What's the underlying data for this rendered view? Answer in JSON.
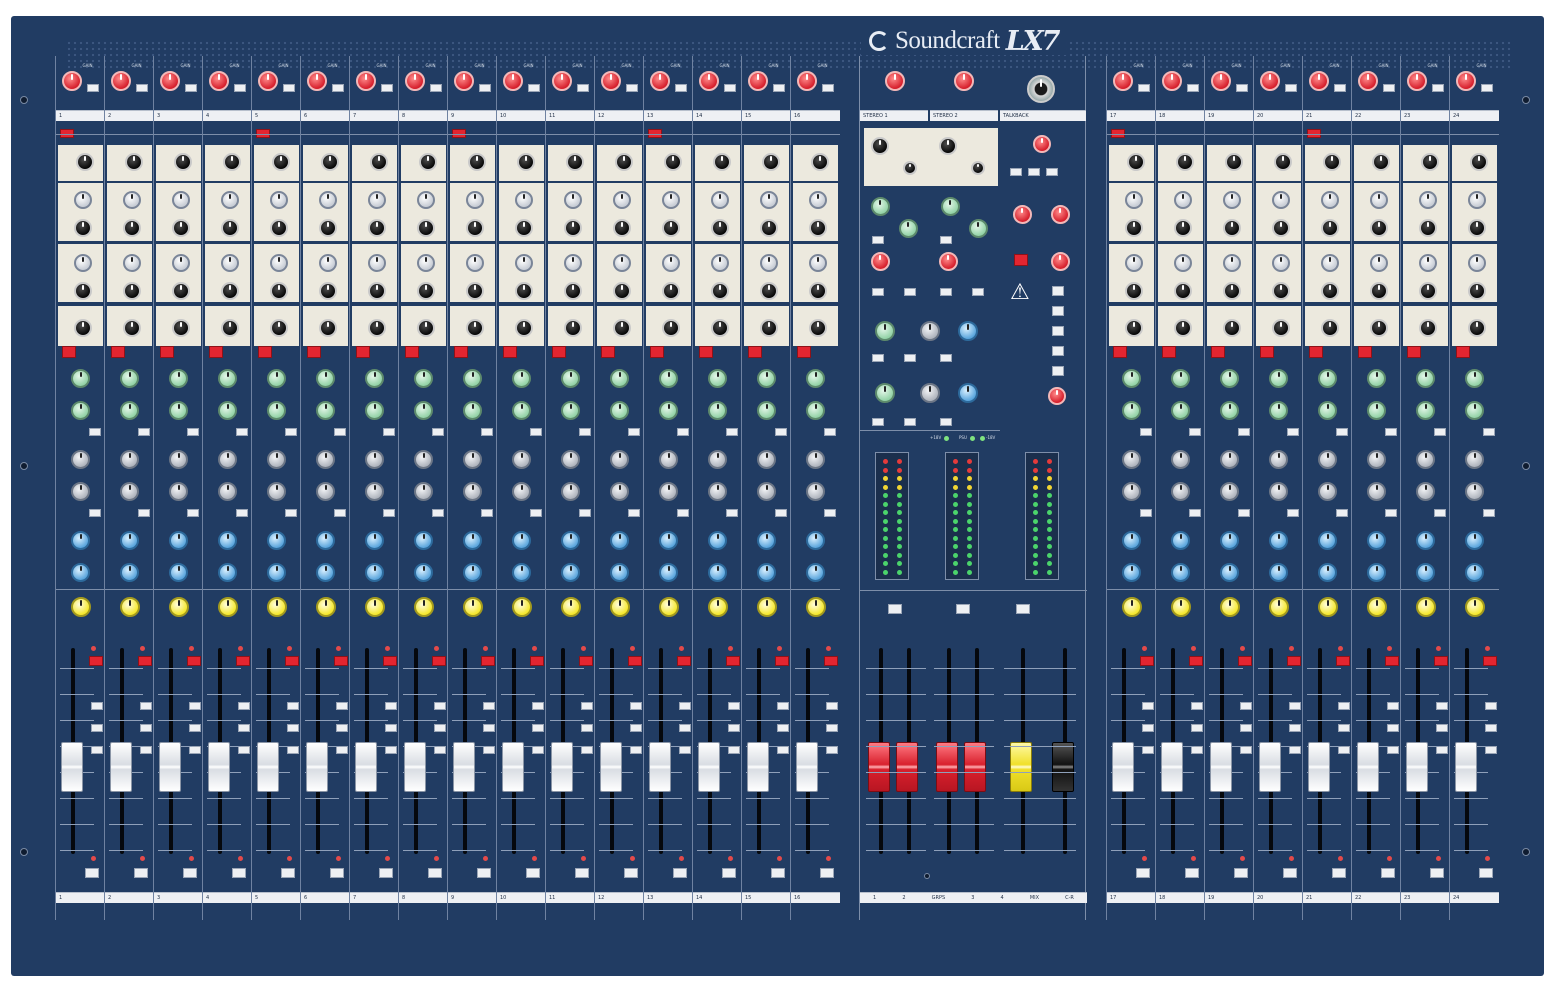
{
  "brand": {
    "name": "Soundcraft",
    "model": "LX7"
  },
  "mono_channels_left": [
    "1",
    "2",
    "3",
    "4",
    "5",
    "6",
    "7",
    "8",
    "9",
    "10",
    "11",
    "12",
    "13",
    "14",
    "15",
    "16"
  ],
  "mono_channels_right": [
    "17",
    "18",
    "19",
    "20",
    "21",
    "22",
    "23",
    "24"
  ],
  "master": {
    "stereo_inputs": [
      "STEREO 1",
      "STEREO 2"
    ],
    "talkback_label": "TALKBACK",
    "meter_voltage_legend": [
      "+18V",
      "PSU",
      "-18V"
    ],
    "fader_group_labels": [
      "1",
      "2",
      "GRPS",
      "3",
      "4",
      "MIX",
      "C-R"
    ]
  },
  "colors": {
    "console": "#213c63",
    "gain_knob": "#d61f2c",
    "eq_knob": "#080808",
    "aux_1_2": "#94d3a7",
    "aux_3_4": "#b0b5be",
    "aux_5_6": "#5ca6dd",
    "pan_knob": "#f5e82e",
    "group_fader": "#d8202d",
    "mix_fader": "#f0e02a",
    "channel_fader": "#ffffff"
  }
}
